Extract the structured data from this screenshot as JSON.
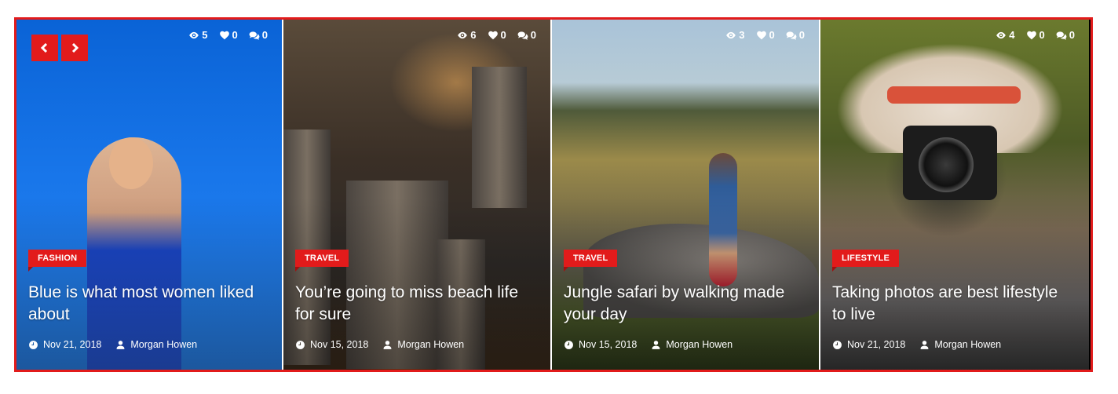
{
  "navigation": {
    "prev_icon": "chevron-left-icon",
    "next_icon": "chevron-right-icon"
  },
  "colors": {
    "accent": "#e21b1b",
    "text": "#ffffff"
  },
  "icons": {
    "views": "eye-icon",
    "likes": "heart-icon",
    "comments": "comments-icon",
    "date": "clock-icon",
    "author": "user-icon"
  },
  "cards": [
    {
      "category": "FASHION",
      "title": "Blue is what most women liked about",
      "date": "Nov 21, 2018",
      "author": "Morgan Howen",
      "views": "5",
      "likes": "0",
      "comments": "0"
    },
    {
      "category": "TRAVEL",
      "title": "You’re going to miss beach life for sure",
      "date": "Nov 15, 2018",
      "author": "Morgan Howen",
      "views": "6",
      "likes": "0",
      "comments": "0"
    },
    {
      "category": "TRAVEL",
      "title": "Jungle safari by walking made your day",
      "date": "Nov 15, 2018",
      "author": "Morgan Howen",
      "views": "3",
      "likes": "0",
      "comments": "0"
    },
    {
      "category": "LIFESTYLE",
      "title": "Taking photos are best lifestyle to live",
      "date": "Nov 21, 2018",
      "author": "Morgan Howen",
      "views": "4",
      "likes": "0",
      "comments": "0"
    }
  ]
}
